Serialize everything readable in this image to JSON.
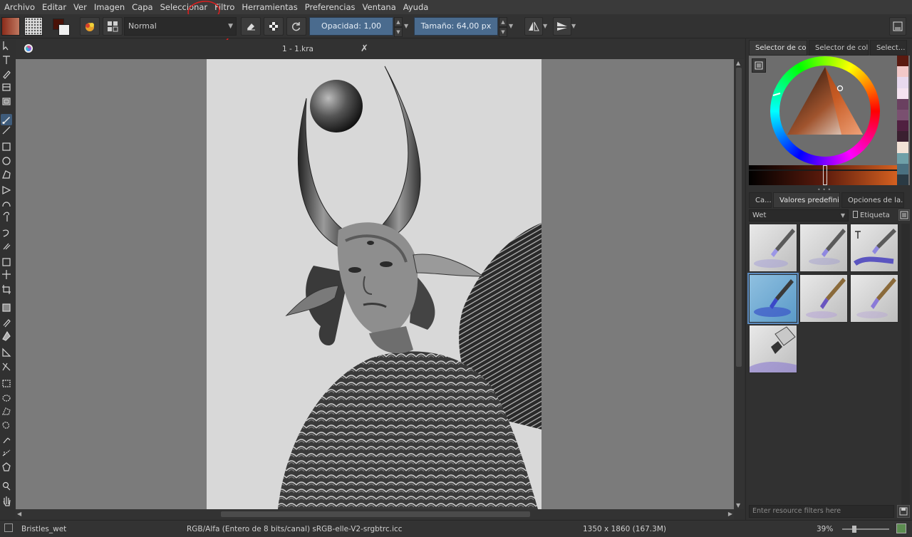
{
  "menu": [
    "Archivo",
    "Editar",
    "Ver",
    "Imagen",
    "Capa",
    "Seleccionar",
    "Filtro",
    "Herramientas",
    "Preferencias",
    "Ventana",
    "Ayuda"
  ],
  "toolbar": {
    "blend_mode": "Normal",
    "opacity_label": "Opacidad:",
    "opacity_value": "1,00",
    "size_label": "Tamaño:",
    "size_value": "64,00 px"
  },
  "document": {
    "tab_title": "1 - 1.kra"
  },
  "dock": {
    "color_tabs": [
      "Selector de co...",
      "Selector de col...",
      "Select..."
    ],
    "preset_tabs": [
      "Ca...",
      "Valores predefini...",
      "Opciones de la..."
    ],
    "preset_filter": "Wet",
    "tag_label": "Etiqueta",
    "resource_filter_placeholder": "Enter resource filters here",
    "palette": [
      "#5a1a10",
      "#f2c8c8",
      "#e8d9ee",
      "#f5e3f0",
      "#6a4060",
      "#7a5070",
      "#502040",
      "#3a2030",
      "#f2e2d6",
      "#6fa0a8",
      "#4a7080",
      "#2a3a44"
    ]
  },
  "status": {
    "brush": "Bristles_wet",
    "colorspace": "RGB/Alfa (Entero de 8 bits/canal)  sRGB-elle-V2-srgbtrc.icc",
    "dimensions": "1350 x 1860 (167.3M)",
    "zoom": "39%"
  }
}
